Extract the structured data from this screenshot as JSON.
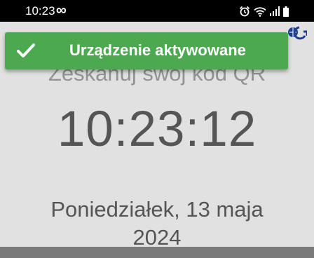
{
  "status_bar": {
    "time": "10:23",
    "infinity": "∞",
    "icons": [
      "alarm-icon",
      "wifi-icon",
      "signal-icon",
      "battery-icon"
    ]
  },
  "screen": {
    "subtitle": "Zeskanuj swój kod QR",
    "clock": "10:23:12",
    "date_line1": "Poniedziałek, 13 maja",
    "date_line2": "2024"
  },
  "toast": {
    "message": "Urządzenie aktywowane",
    "icon": "checkmark-icon",
    "color": "#4ca94f"
  },
  "colors": {
    "background": "#e1e1e1",
    "text": "#555555",
    "logo": "#1f3f8f"
  }
}
